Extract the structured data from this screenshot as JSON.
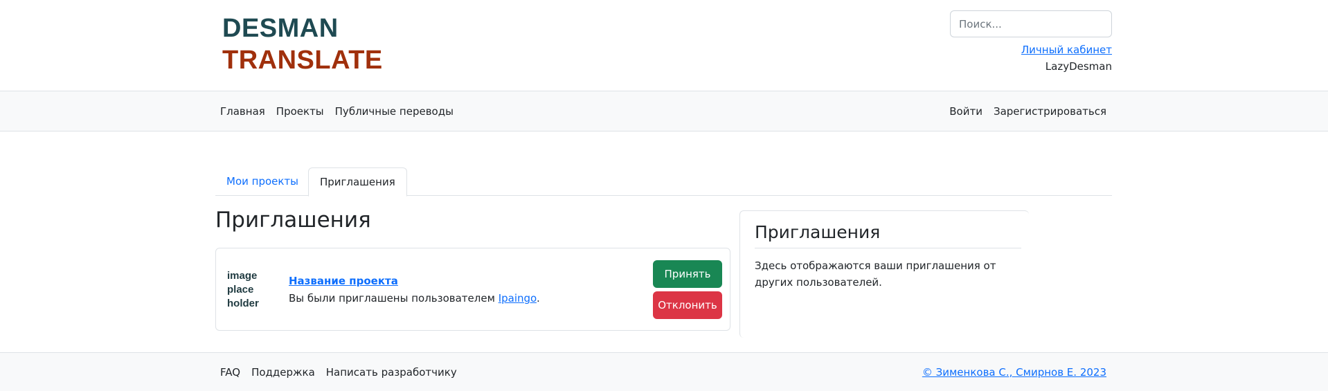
{
  "header": {
    "logo_line1": "DESMAN",
    "logo_line2": "TRANSLATE",
    "search_placeholder": "Поиск...",
    "cabinet_link": "Личный кабинет",
    "username": "LazyDesman"
  },
  "navbar": {
    "left": [
      "Главная",
      "Проекты",
      "Публичные переводы"
    ],
    "right": [
      "Войти",
      "Зарегистрироваться"
    ]
  },
  "tabs": {
    "my_projects": "Мои проекты",
    "invitations": "Приглашения"
  },
  "main": {
    "title": "Приглашения",
    "invite": {
      "image_placeholder_line1": "image",
      "image_placeholder_line2": "place",
      "image_placeholder_line3": "holder",
      "project_name": "Название проекта",
      "text_prefix": "Вы были приглашены пользователем ",
      "inviter": "Ipaingo",
      "text_suffix": ".",
      "accept_label": "Принять",
      "decline_label": "Отклонить"
    }
  },
  "info": {
    "title": "Приглашения",
    "text": "Здесь отображаются ваши приглашения от других пользователей."
  },
  "footer": {
    "links": [
      "FAQ",
      "Поддержка",
      "Написать разработчику"
    ],
    "copyright": "© Зименкова С., Смирнов Е. 2023"
  },
  "colors": {
    "logo_dark": "#1f4a52",
    "logo_accent": "#a0300c",
    "link": "#0d6efd",
    "accept": "#198754",
    "decline": "#dc3545"
  }
}
